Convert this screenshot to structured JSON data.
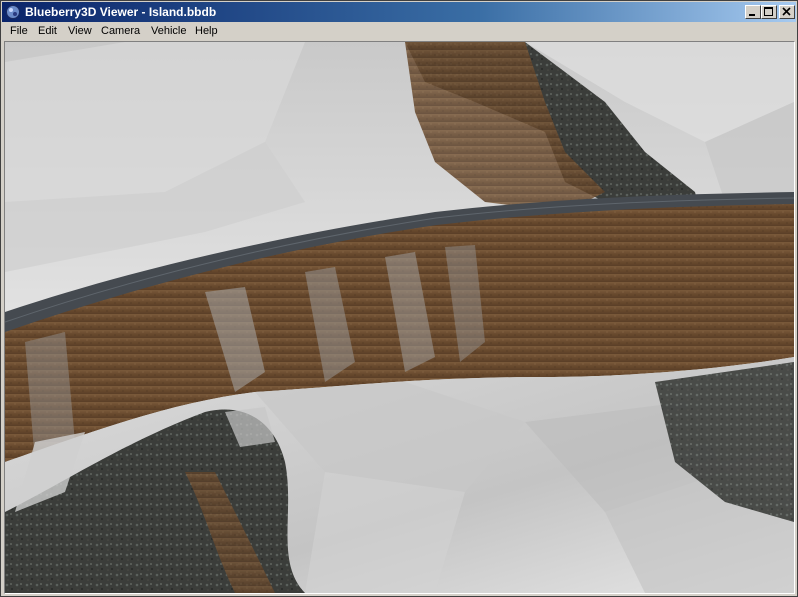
{
  "window": {
    "title": "Blueberry3D Viewer - Island.bbdb",
    "app_icon": "blueberry-app-icon"
  },
  "caption_buttons": {
    "minimize": "minimize-icon",
    "maximize": "maximize-icon",
    "close": "close-icon"
  },
  "menu": {
    "file": "File",
    "edit": "Edit",
    "view": "View",
    "camera": "Camera",
    "vehicle": "Vehicle",
    "help": "Help"
  },
  "viewport": {
    "content": "3d-terrain-render",
    "colors": {
      "snow": "#d8d8d8",
      "snow_shadow": "#9a9a9a",
      "dirt": "#6e4f32",
      "rock": "#3a3d3a",
      "road": "#454a50"
    }
  }
}
